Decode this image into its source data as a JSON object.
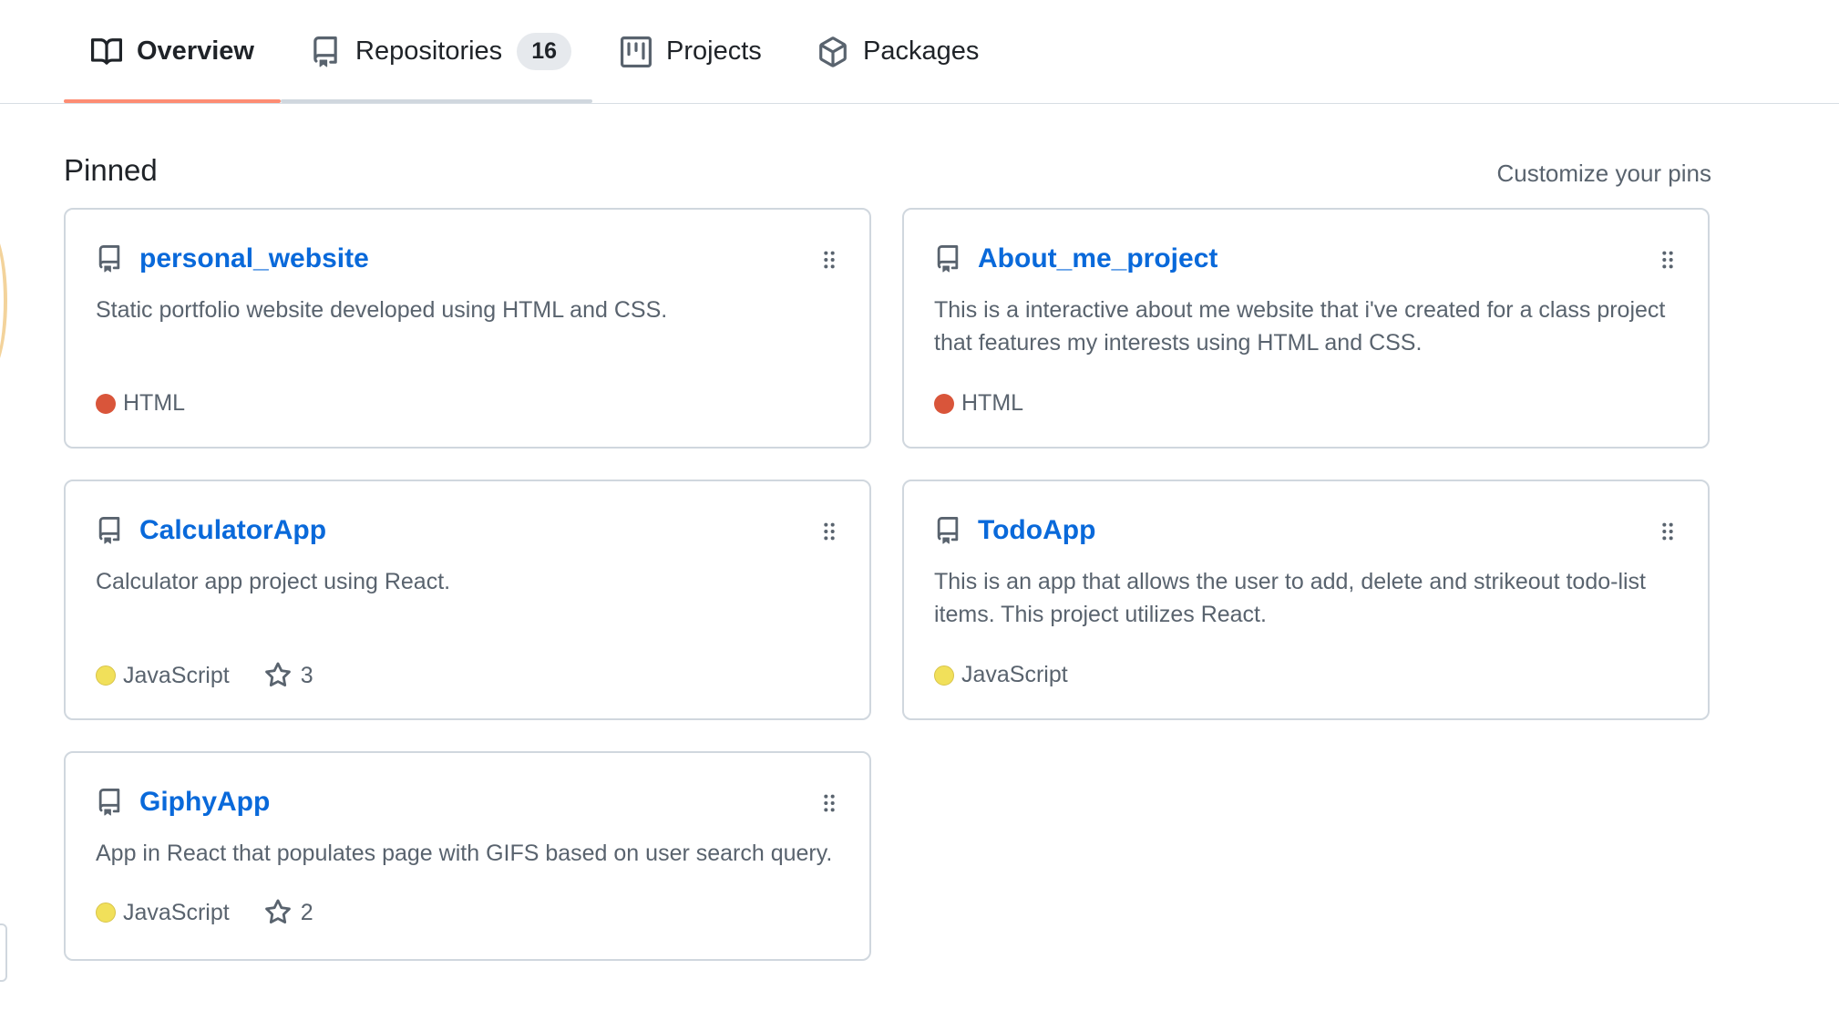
{
  "tabs": [
    {
      "label": "Overview",
      "icon": "book-icon",
      "active": true
    },
    {
      "label": "Repositories",
      "icon": "repo-icon",
      "count": "16"
    },
    {
      "label": "Projects",
      "icon": "project-icon"
    },
    {
      "label": "Packages",
      "icon": "package-icon"
    }
  ],
  "pinned": {
    "title": "Pinned",
    "customize_label": "Customize your pins",
    "cards": [
      {
        "name": "personal_website",
        "description": "Static portfolio website developed using HTML and CSS.",
        "language": "HTML",
        "language_color": "#e34c26",
        "stars": ""
      },
      {
        "name": "About_me_project",
        "description": "This is a interactive about me website that i've created for a class project that features my interests using HTML and CSS.",
        "language": "HTML",
        "language_color": "#e34c26",
        "stars": ""
      },
      {
        "name": "CalculatorApp",
        "description": "Calculator app project using React.",
        "language": "JavaScript",
        "language_color": "#f1e05a",
        "stars": "3"
      },
      {
        "name": "TodoApp",
        "description": "This is an app that allows the user to add, delete and strikeout todo-list items. This project utilizes React.",
        "language": "JavaScript",
        "language_color": "#f1e05a",
        "stars": ""
      },
      {
        "name": "GiphyApp",
        "description": "App in React that populates page with GIFS based on user search query.",
        "language": "JavaScript",
        "language_color": "#f1e05a",
        "stars": "2"
      }
    ]
  },
  "colors": {
    "link": "#0969da",
    "accent_underline": "#fd8c73",
    "muted": "#59636e",
    "border": "#d0d7de"
  }
}
